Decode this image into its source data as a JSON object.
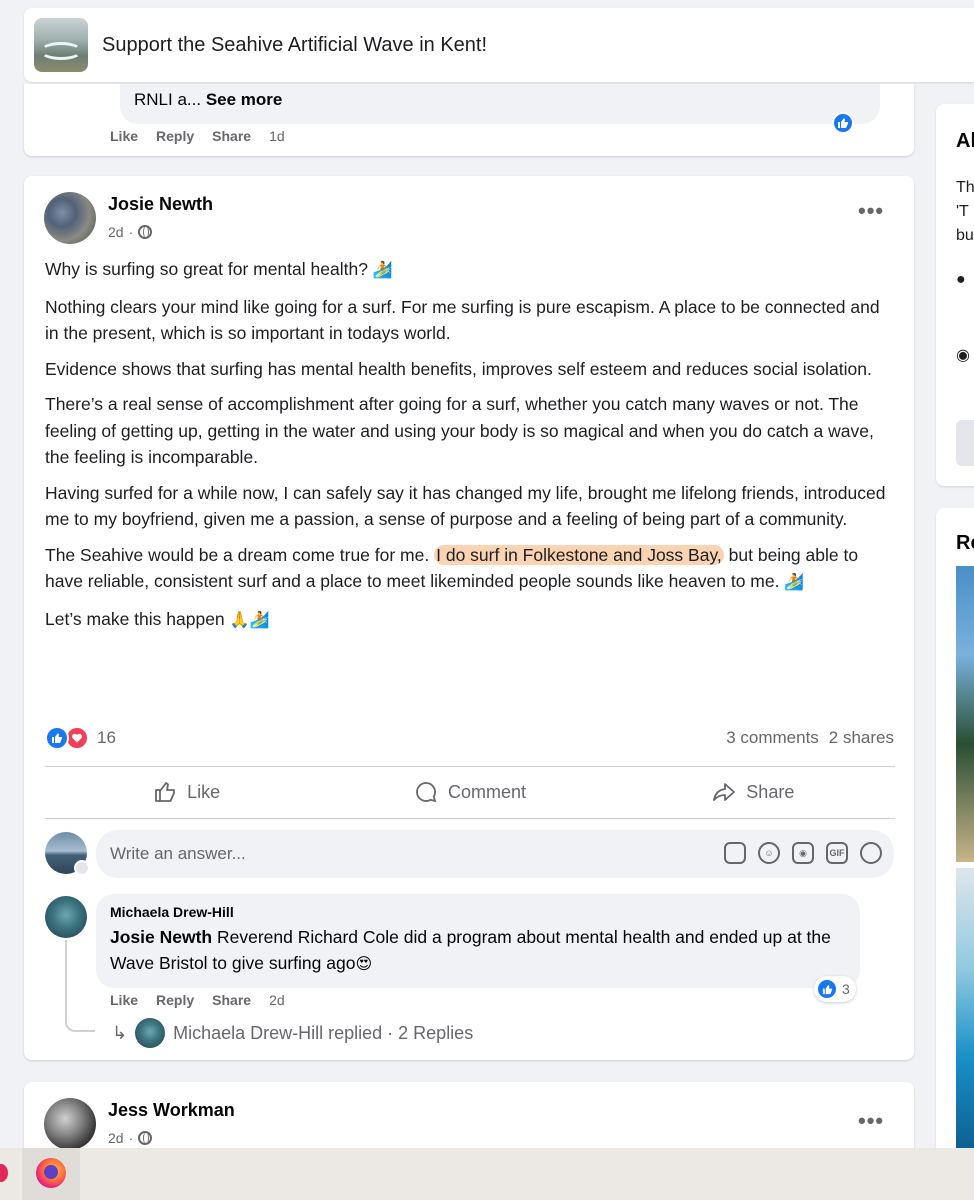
{
  "group": {
    "title": "Support the Seahive Artificial Wave in Kent!"
  },
  "prev_comment": {
    "text": "RNLI a...",
    "see_more": "See more",
    "like": "Like",
    "reply": "Reply",
    "share": "Share",
    "time": "1d"
  },
  "post": {
    "author": "Josie Newth",
    "time": "2d",
    "paragraphs": {
      "p1": "Why is surfing so great for mental health?",
      "p2": "Nothing clears your mind like going for a surf. For me surfing is pure escapism. A place to be connected and in the present, which is so important in todays world.",
      "p3": "Evidence shows that surfing has mental health benefits, improves self esteem and reduces social isolation.",
      "p4": "There’s a real sense of accomplishment after going for a surf, whether you catch many waves or not. The feeling of getting up, getting in the water and using your body is so magical and when you do catch a wave, the feeling is incomparable.",
      "p5": "Having surfed for a while now, I can safely say it has changed my life, brought me lifelong friends, introduced me to my boyfriend, given me a passion, a sense of purpose and a feeling of being part of a community.",
      "p6_start": "The Seahive would be a dream come true for me.",
      "p6_highlight": "I do surf in Folkestone and Joss Bay,",
      "p6_end": "but being able to have reliable, consistent surf and a place to meet likeminded people sounds like heaven to me.",
      "p7": "Let’s make this happen"
    },
    "reaction_count": "16",
    "comments_count": "3 comments",
    "shares_count": "2 shares",
    "actions": {
      "like": "Like",
      "comment": "Comment",
      "share": "Share"
    },
    "answer_placeholder": "Write an answer...",
    "answer_icons": [
      "sticker-icon",
      "emoji-icon",
      "camera-icon",
      "gif-icon",
      "avatar-sticker-icon"
    ],
    "gif_label": "GIF"
  },
  "comment": {
    "author": "Michaela Drew-Hill",
    "mention": "Josie Newth",
    "text": "Reverend Richard Cole did a program about mental health and ended up at the Wave Bristol to give surfing ago",
    "like": "Like",
    "reply": "Reply",
    "share": "Share",
    "time": "2d",
    "reaction_count": "3",
    "replies_text": "Michaela Drew-Hill replied · 2 Replies"
  },
  "next_post": {
    "author": "Jess Workman",
    "time": "2d"
  },
  "sidebar": {
    "card1_head": "Al",
    "card1_lines": [
      "Th",
      "'T",
      "bu"
    ],
    "card2_head": "Re"
  },
  "colors": {
    "accent": "#1877f2",
    "love": "#f33e58",
    "highlight": "#fad3b2",
    "muted": "#65676b"
  }
}
